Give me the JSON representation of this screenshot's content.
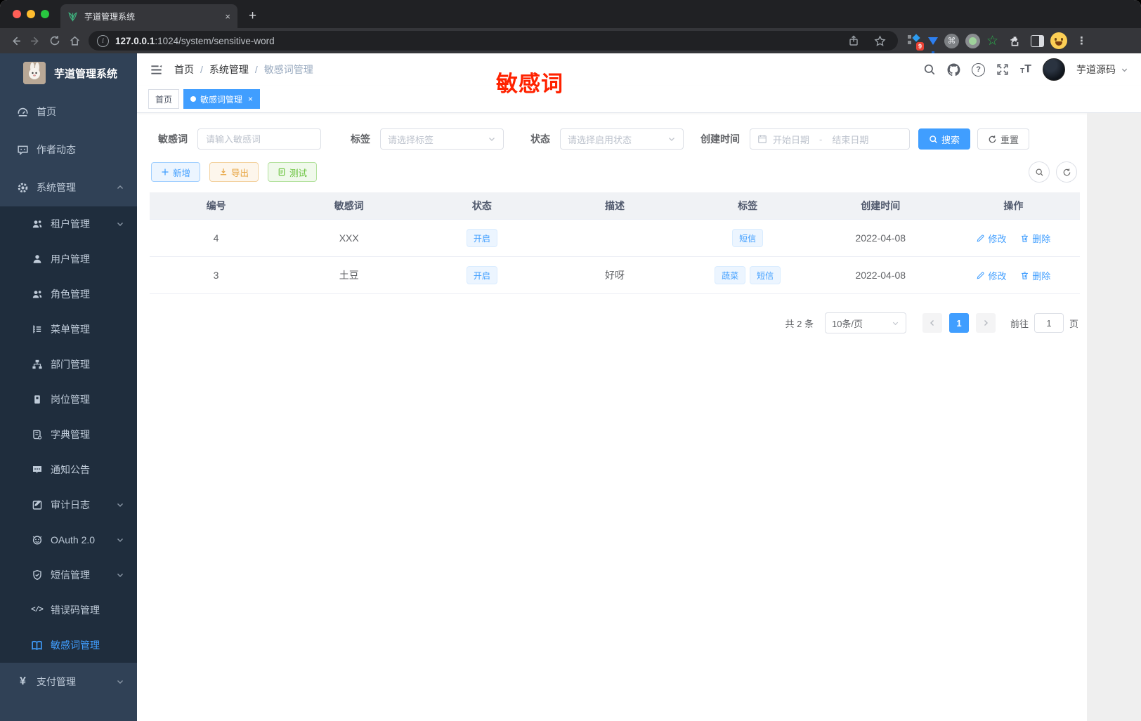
{
  "browser": {
    "tab_title": "芋道管理系统",
    "tab_close": "×",
    "new_tab": "+",
    "url_host": "127.0.0.1",
    "url_rest": ":1024/system/sensitive-word",
    "ext_badge": "9",
    "cmd_glyph": "⌘",
    "star_glyph": "☆",
    "kebab_glyph": "⋮"
  },
  "sidebar": {
    "logo_title": "芋道管理系统",
    "items": [
      {
        "label": "首页",
        "icon": "dashboard-icon"
      },
      {
        "label": "作者动态",
        "icon": "chat-icon"
      },
      {
        "label": "系统管理",
        "icon": "gear-icon",
        "arrow": "up"
      },
      {
        "label": "租户管理",
        "icon": "users-icon",
        "arrow": "down"
      },
      {
        "label": "用户管理",
        "icon": "user-icon"
      },
      {
        "label": "角色管理",
        "icon": "roles-icon"
      },
      {
        "label": "菜单管理",
        "icon": "menu-list-icon"
      },
      {
        "label": "部门管理",
        "icon": "org-icon"
      },
      {
        "label": "岗位管理",
        "icon": "badge-icon"
      },
      {
        "label": "字典管理",
        "icon": "dict-icon"
      },
      {
        "label": "通知公告",
        "icon": "notice-icon"
      },
      {
        "label": "审计日志",
        "icon": "audit-icon",
        "arrow": "down"
      },
      {
        "label": "OAuth 2.0",
        "icon": "oauth-icon",
        "arrow": "down"
      },
      {
        "label": "短信管理",
        "icon": "shield-icon",
        "arrow": "down"
      },
      {
        "label": "错误码管理",
        "icon": "code-icon",
        "code_glyph": "</>"
      },
      {
        "label": "敏感词管理",
        "icon": "open-book-icon",
        "active": true
      },
      {
        "label": "支付管理",
        "icon": "yen-icon",
        "yen_glyph": "¥",
        "arrow": "down"
      }
    ]
  },
  "navbar": {
    "breadcrumb": [
      "首页",
      "系统管理",
      "敏感词管理"
    ],
    "separator": "/",
    "username": "芋道源码",
    "help_glyph": "?"
  },
  "annotation": {
    "text": "敏感词",
    "color": "#ff2200"
  },
  "tagsview": {
    "tags": [
      {
        "label": "首页",
        "active": false
      },
      {
        "label": "敏感词管理",
        "active": true,
        "close": "×"
      }
    ]
  },
  "filters": {
    "word": {
      "label": "敏感词",
      "placeholder": "请输入敏感词"
    },
    "tag": {
      "label": "标签",
      "placeholder": "请选择标签"
    },
    "status": {
      "label": "状态",
      "placeholder": "请选择启用状态"
    },
    "created": {
      "label": "创建时间",
      "start_placeholder": "开始日期",
      "separator": "-",
      "end_placeholder": "结束日期"
    },
    "search_label": "搜索",
    "reset_label": "重置"
  },
  "toolbar": {
    "add_label": "新增",
    "export_label": "导出",
    "test_label": "测试"
  },
  "table": {
    "columns": [
      "编号",
      "敏感词",
      "状态",
      "描述",
      "标签",
      "创建时间",
      "操作"
    ],
    "rows": [
      {
        "id": "4",
        "word": "XXX",
        "status": "开启",
        "desc": "",
        "tags": [
          "短信"
        ],
        "created": "2022-04-08"
      },
      {
        "id": "3",
        "word": "土豆",
        "status": "开启",
        "desc": "好呀",
        "tags": [
          "蔬菜",
          "短信"
        ],
        "created": "2022-04-08"
      }
    ],
    "edit_label": "修改",
    "delete_label": "删除"
  },
  "pagination": {
    "total": "共 2 条",
    "page_size": "10条/页",
    "page": "1",
    "goto_label": "前往",
    "goto_value": "1",
    "unit_label": "页"
  },
  "colors": {
    "primary": "#409eff",
    "warning": "#e6a23c",
    "success": "#67c23a",
    "annotation_red": "#ff2200"
  }
}
